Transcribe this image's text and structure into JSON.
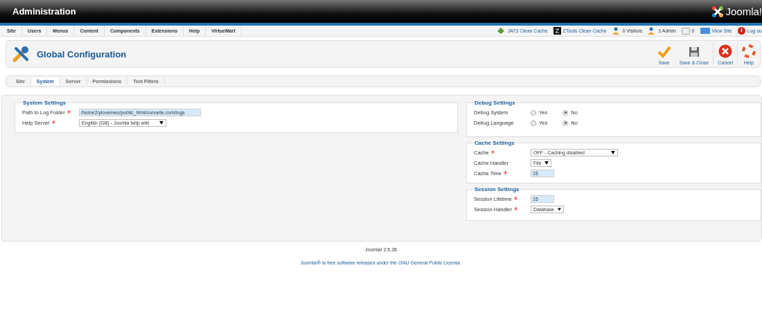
{
  "header": {
    "title": "Administration",
    "logo": "Joomla!"
  },
  "menu": [
    "Site",
    "Users",
    "Menus",
    "Content",
    "Components",
    "Extensions",
    "Help",
    "VirtueMart"
  ],
  "status": [
    {
      "kind": "cache",
      "label": "JAT3 Clean Cache",
      "link": true
    },
    {
      "kind": "z",
      "label": "ZTools Clean Cache",
      "link": true
    },
    {
      "kind": "users",
      "label": "0 Visitors",
      "link": false
    },
    {
      "kind": "users",
      "label": "1 Admin",
      "link": false
    },
    {
      "kind": "mail",
      "label": "0",
      "link": false
    },
    {
      "kind": "view",
      "label": "View Site",
      "link": true
    },
    {
      "kind": "logout",
      "label": "Log ou",
      "link": true
    }
  ],
  "page_title": "Global Configuration",
  "toolbar": [
    {
      "kind": "save",
      "label": "Save"
    },
    {
      "kind": "saveclose",
      "label": "Save & Close"
    },
    {
      "kind": "cancel",
      "label": "Cancel"
    },
    {
      "kind": "help",
      "label": "Help"
    }
  ],
  "tabs": [
    {
      "label": "Site",
      "selected": false
    },
    {
      "label": "System",
      "selected": true
    },
    {
      "label": "Server",
      "selected": false
    },
    {
      "label": "Permissions",
      "selected": false
    },
    {
      "label": "Text Filters",
      "selected": false
    }
  ],
  "left": [
    {
      "title": "System Settings",
      "fields": [
        {
          "label": "Path to Log Folder",
          "required": true,
          "kind": "text",
          "value": "/home2/ylovemeo/public_html/curvarte.com/logs"
        },
        {
          "label": "Help Server",
          "required": true,
          "kind": "select",
          "value": "English (GB) - Joomla help wiki"
        }
      ]
    }
  ],
  "right": [
    {
      "title": "Debug Settings",
      "fields": [
        {
          "label": "Debug System",
          "required": false,
          "kind": "radio",
          "options": [
            {
              "label": "Yes",
              "selected": false
            },
            {
              "label": "No",
              "selected": true
            }
          ]
        },
        {
          "label": "Debug Language",
          "required": false,
          "kind": "radio",
          "options": [
            {
              "label": "Yes",
              "selected": false
            },
            {
              "label": "No",
              "selected": true
            }
          ]
        }
      ]
    },
    {
      "title": "Cache Settings",
      "fields": [
        {
          "label": "Cache",
          "required": true,
          "kind": "select",
          "value": "OFF - Caching disabled"
        },
        {
          "label": "Cache Handler",
          "required": false,
          "kind": "select",
          "value": "File"
        },
        {
          "label": "Cache Time",
          "required": true,
          "kind": "text",
          "value": "15"
        }
      ]
    },
    {
      "title": "Session Settings",
      "fields": [
        {
          "label": "Session Lifetime",
          "required": true,
          "kind": "text",
          "value": "15"
        },
        {
          "label": "Session Handler",
          "required": true,
          "kind": "select",
          "value": "Database"
        }
      ]
    }
  ],
  "footer": {
    "version": "Joomla! 2.5.28",
    "license_prefix": "Joomla!® is free software released under the",
    "license_link": "GNU General Public License."
  }
}
